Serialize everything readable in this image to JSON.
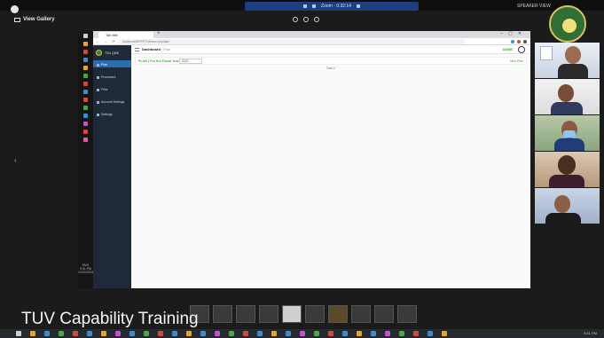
{
  "meeting": {
    "top_bar_text": "Zoom · 0:32:14",
    "top_right_text": "SPEAKER VIEW",
    "view_gallery_label": "View Gallery",
    "caption": "TUV Capability Training"
  },
  "browser": {
    "tab_title": "Tab title",
    "url": "localhost/WPSPTS/index.php/plan"
  },
  "app": {
    "brand_text": "TSU QMS",
    "menu": [
      {
        "label": "Plan"
      },
      {
        "label": "Processes"
      },
      {
        "label": "Files"
      },
      {
        "label": "Account Settings"
      },
      {
        "label": "Settings"
      }
    ],
    "breadcrumb_root": "Dashboard",
    "breadcrumb_current": "Plan",
    "user_label": "ADMIN",
    "plan_title": "PLAN | For the Fiscal Year",
    "fiscal_year": "2021",
    "new_plan_label": "New Plan",
    "status_text": "Total 0"
  },
  "os": {
    "clock_time": "9:41 PM",
    "clock_date": "10/20/2021",
    "eng": "ENG"
  },
  "colors": {
    "sidebar_bg": "#1e2a3a",
    "active_menu": "#2b6cb0",
    "accent_green": "#4aa83a",
    "zoom_blue": "#1c3f80"
  }
}
